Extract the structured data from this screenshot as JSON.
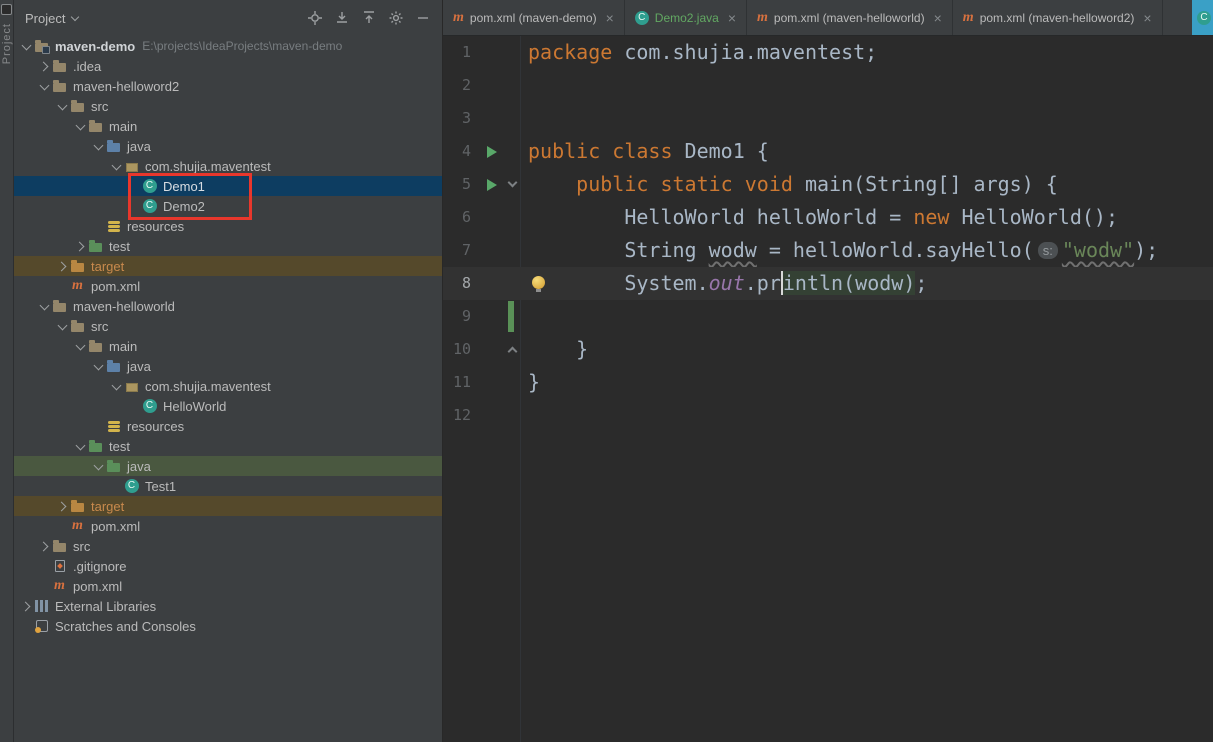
{
  "stripe": {
    "tool_button": "Project"
  },
  "icons": {
    "close": "×",
    "class_letter": "C",
    "maven_letter": "m"
  },
  "project_panel": {
    "title": "Project",
    "items": [
      {
        "label": "maven-demo",
        "path_hint": "E:\\projects\\IdeaProjects\\maven-demo",
        "level": 0,
        "state": "expanded",
        "icon": "project-folder"
      },
      {
        "label": ".idea",
        "level": 1,
        "state": "collapsed",
        "icon": "folder"
      },
      {
        "label": "maven-helloword2",
        "level": 1,
        "state": "expanded",
        "icon": "folder"
      },
      {
        "label": "src",
        "level": 2,
        "state": "expanded",
        "icon": "folder"
      },
      {
        "label": "main",
        "level": 3,
        "state": "expanded",
        "icon": "folder"
      },
      {
        "label": "java",
        "level": 4,
        "state": "expanded",
        "icon": "source-folder"
      },
      {
        "label": "com.shujia.maventest",
        "level": 5,
        "state": "expanded",
        "icon": "package"
      },
      {
        "label": "Demo1",
        "level": 6,
        "state": "leaf",
        "icon": "class",
        "selected": true
      },
      {
        "label": "Demo2",
        "level": 6,
        "state": "leaf",
        "icon": "class"
      },
      {
        "label": "resources",
        "level": 4,
        "state": "leaf",
        "icon": "resources"
      },
      {
        "label": "test",
        "level": 3,
        "state": "collapsed",
        "icon": "test-folder"
      },
      {
        "label": "target",
        "level": 2,
        "state": "collapsed",
        "icon": "excluded-folder",
        "excluded": true
      },
      {
        "label": "pom.xml",
        "level": 2,
        "state": "leaf",
        "icon": "maven"
      },
      {
        "label": "maven-helloworld",
        "level": 1,
        "state": "expanded",
        "icon": "folder"
      },
      {
        "label": "src",
        "level": 2,
        "state": "expanded",
        "icon": "folder"
      },
      {
        "label": "main",
        "level": 3,
        "state": "expanded",
        "icon": "folder"
      },
      {
        "label": "java",
        "level": 4,
        "state": "expanded",
        "icon": "source-folder"
      },
      {
        "label": "com.shujia.maventest",
        "level": 5,
        "state": "expanded",
        "icon": "package"
      },
      {
        "label": "HelloWorld",
        "level": 6,
        "state": "leaf",
        "icon": "class"
      },
      {
        "label": "resources",
        "level": 4,
        "state": "leaf",
        "icon": "resources"
      },
      {
        "label": "test",
        "level": 3,
        "state": "expanded",
        "icon": "test-folder"
      },
      {
        "label": "java",
        "level": 4,
        "state": "expanded",
        "icon": "test-folder",
        "highlighted": "test-source"
      },
      {
        "label": "Test1",
        "level": 5,
        "state": "leaf",
        "icon": "class"
      },
      {
        "label": "target",
        "level": 2,
        "state": "collapsed",
        "icon": "excluded-folder",
        "excluded": true
      },
      {
        "label": "pom.xml",
        "level": 2,
        "state": "leaf",
        "icon": "maven"
      },
      {
        "label": "src",
        "level": 1,
        "state": "collapsed",
        "icon": "folder"
      },
      {
        "label": ".gitignore",
        "level": 1,
        "state": "leaf",
        "icon": "file"
      },
      {
        "label": "pom.xml",
        "level": 1,
        "state": "leaf",
        "icon": "maven"
      },
      {
        "label": "External Libraries",
        "level": 0,
        "state": "collapsed",
        "icon": "libraries"
      },
      {
        "label": "Scratches and Consoles",
        "level": 0,
        "state": "leaf",
        "icon": "scratches"
      }
    ]
  },
  "editor": {
    "tabs": [
      {
        "label": "pom.xml (maven-demo)",
        "icon": "maven"
      },
      {
        "label": "Demo2.java",
        "icon": "class",
        "status": "added"
      },
      {
        "label": "pom.xml (maven-helloworld)",
        "icon": "maven"
      },
      {
        "label": "pom.xml (maven-helloword2)",
        "icon": "maven"
      },
      {
        "label": "",
        "icon": "class",
        "active": true
      }
    ],
    "line_numbers": [
      "1",
      "2",
      "3",
      "4",
      "5",
      "6",
      "7",
      "8",
      "9",
      "10",
      "11",
      "12"
    ],
    "lines": [
      {
        "segs": [
          {
            "t": "package "
          },
          {
            "t": "com.shujia.maventest;"
          }
        ]
      },
      {
        "segs": []
      },
      {
        "segs": []
      },
      {
        "segs": [
          {
            "t": "public class "
          },
          {
            "t": "Demo1 {"
          }
        ]
      },
      {
        "segs": [
          {
            "t": "    "
          },
          {
            "t": "public static void "
          },
          {
            "t": "main(String[] args) {"
          }
        ]
      },
      {
        "segs": [
          {
            "t": "        HelloWorld helloWorld = "
          },
          {
            "t": "new"
          },
          {
            "t": " HelloWorld();"
          }
        ]
      },
      {
        "segs": [
          {
            "t": "        String "
          },
          {
            "t": "wodw"
          },
          {
            "t": " = helloWorld.sayHello("
          },
          {
            "t": "s:"
          },
          {
            "t": "\"wodw\""
          },
          {
            "t": ");"
          }
        ]
      },
      {
        "segs": [
          {
            "t": "        System."
          },
          {
            "t": "out"
          },
          {
            "t": "."
          },
          {
            "t": "pr"
          },
          {
            "t": "intln"
          },
          {
            "t": "(wodw)"
          },
          {
            "t": ";"
          }
        ]
      },
      {
        "segs": []
      },
      {
        "segs": [
          {
            "t": "    }"
          }
        ]
      },
      {
        "segs": [
          {
            "t": "}"
          }
        ]
      },
      {
        "segs": []
      }
    ]
  }
}
